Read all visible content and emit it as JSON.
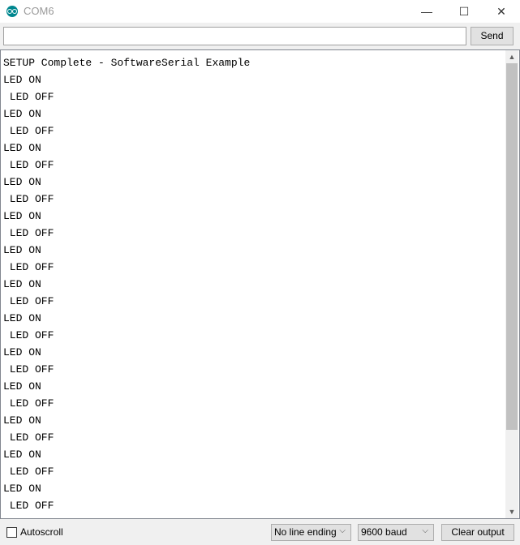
{
  "window": {
    "title": "COM6",
    "minimize": "—",
    "maximize": "☐",
    "close": "✕"
  },
  "send_row": {
    "input_value": "",
    "send_label": "Send"
  },
  "output": {
    "lines": [
      "SETUP Complete - SoftwareSerial Example",
      "LED ON",
      " LED OFF",
      "LED ON",
      " LED OFF",
      "LED ON",
      " LED OFF",
      "LED ON",
      " LED OFF",
      "LED ON",
      " LED OFF",
      "LED ON",
      " LED OFF",
      "LED ON",
      " LED OFF",
      "LED ON",
      " LED OFF",
      "LED ON",
      " LED OFF",
      "LED ON",
      " LED OFF",
      "LED ON",
      " LED OFF",
      "LED ON",
      " LED OFF",
      "LED ON",
      " LED OFF",
      "LED ON"
    ]
  },
  "bottom": {
    "autoscroll_label": "Autoscroll",
    "autoscroll_checked": false,
    "line_ending": "No line ending",
    "baud": "9600 baud",
    "clear_label": "Clear output"
  },
  "colors": {
    "logo": "#00878f"
  }
}
